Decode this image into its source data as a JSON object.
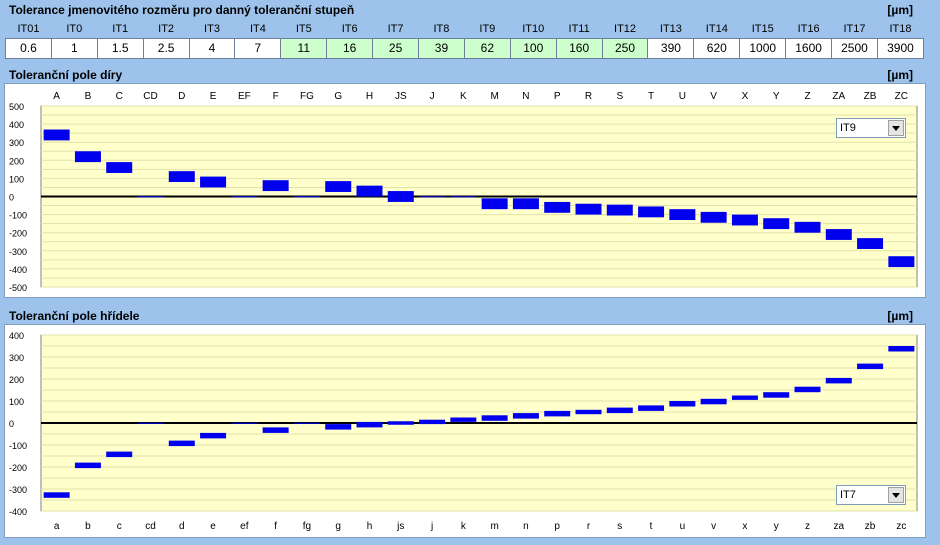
{
  "tolerance_section": {
    "title": "Tolerance jmenovitého rozměru pro danný toleranční stupeň",
    "unit": "[µm]",
    "grades": [
      "IT01",
      "IT0",
      "IT1",
      "IT2",
      "IT3",
      "IT4",
      "IT5",
      "IT6",
      "IT7",
      "IT8",
      "IT9",
      "IT10",
      "IT11",
      "IT12",
      "IT13",
      "IT14",
      "IT15",
      "IT16",
      "IT17",
      "IT18"
    ],
    "values": [
      "0.6",
      "1",
      "1.5",
      "2.5",
      "4",
      "7",
      "11",
      "16",
      "25",
      "39",
      "62",
      "100",
      "160",
      "250",
      "390",
      "620",
      "1000",
      "1600",
      "2500",
      "3900"
    ],
    "highlighted": [
      false,
      false,
      false,
      false,
      false,
      false,
      true,
      true,
      true,
      true,
      true,
      true,
      true,
      true,
      false,
      false,
      false,
      false,
      false,
      false
    ]
  },
  "hole_section": {
    "title": "Toleranční pole díry",
    "unit": "[µm]",
    "selector_value": "IT9"
  },
  "shaft_section": {
    "title": "Toleranční pole hřídele",
    "unit": "[µm]",
    "selector_value": "IT7"
  },
  "chart_data": [
    {
      "type": "bar",
      "name": "hole",
      "categories": [
        "A",
        "B",
        "C",
        "CD",
        "D",
        "E",
        "EF",
        "F",
        "FG",
        "G",
        "H",
        "JS",
        "J",
        "K",
        "M",
        "N",
        "P",
        "R",
        "S",
        "T",
        "U",
        "V",
        "X",
        "Y",
        "Z",
        "ZA",
        "ZB",
        "ZC"
      ],
      "ranges": [
        [
          310,
          370
        ],
        [
          190,
          250
        ],
        [
          130,
          190
        ],
        [
          -1,
          1
        ],
        [
          80,
          140
        ],
        [
          50,
          110
        ],
        [
          -1,
          1
        ],
        [
          30,
          90
        ],
        [
          -1,
          1
        ],
        [
          25,
          85
        ],
        [
          0,
          60
        ],
        [
          -30,
          30
        ],
        [
          -1,
          1
        ],
        [
          -1,
          1
        ],
        [
          -70,
          -10
        ],
        [
          -70,
          -10
        ],
        [
          -90,
          -30
        ],
        [
          -100,
          -40
        ],
        [
          -105,
          -45
        ],
        [
          -115,
          -55
        ],
        [
          -130,
          -70
        ],
        [
          -145,
          -85
        ],
        [
          -160,
          -100
        ],
        [
          -180,
          -120
        ],
        [
          -200,
          -140
        ],
        [
          -240,
          -180
        ],
        [
          -290,
          -230
        ],
        [
          -390,
          -330
        ]
      ],
      "ylim": [
        -500,
        500
      ],
      "yticks": [
        500,
        400,
        300,
        200,
        100,
        0,
        -100,
        -200,
        -300,
        -400,
        -500
      ],
      "grid": true,
      "bar_color": "#0000ee"
    },
    {
      "type": "bar",
      "name": "shaft",
      "categories": [
        "a",
        "b",
        "c",
        "cd",
        "d",
        "e",
        "ef",
        "f",
        "fg",
        "g",
        "h",
        "js",
        "j",
        "k",
        "m",
        "n",
        "p",
        "r",
        "s",
        "t",
        "u",
        "v",
        "x",
        "y",
        "z",
        "za",
        "zb",
        "zc"
      ],
      "ranges": [
        [
          -340,
          -315
        ],
        [
          -205,
          -180
        ],
        [
          -155,
          -130
        ],
        [
          -1,
          1
        ],
        [
          -105,
          -80
        ],
        [
          -70,
          -45
        ],
        [
          -1,
          1
        ],
        [
          -45,
          -20
        ],
        [
          -1,
          1
        ],
        [
          -30,
          -5
        ],
        [
          -20,
          5
        ],
        [
          -8,
          8
        ],
        [
          -5,
          15
        ],
        [
          5,
          25
        ],
        [
          10,
          35
        ],
        [
          20,
          45
        ],
        [
          30,
          55
        ],
        [
          40,
          60
        ],
        [
          45,
          70
        ],
        [
          55,
          80
        ],
        [
          75,
          100
        ],
        [
          85,
          110
        ],
        [
          105,
          125
        ],
        [
          115,
          140
        ],
        [
          140,
          165
        ],
        [
          180,
          205
        ],
        [
          245,
          270
        ],
        [
          325,
          350
        ]
      ],
      "ylim": [
        -400,
        400
      ],
      "yticks": [
        400,
        300,
        200,
        100,
        0,
        -100,
        -200,
        -300,
        -400
      ],
      "grid": true,
      "bar_color": "#0000ee"
    }
  ]
}
